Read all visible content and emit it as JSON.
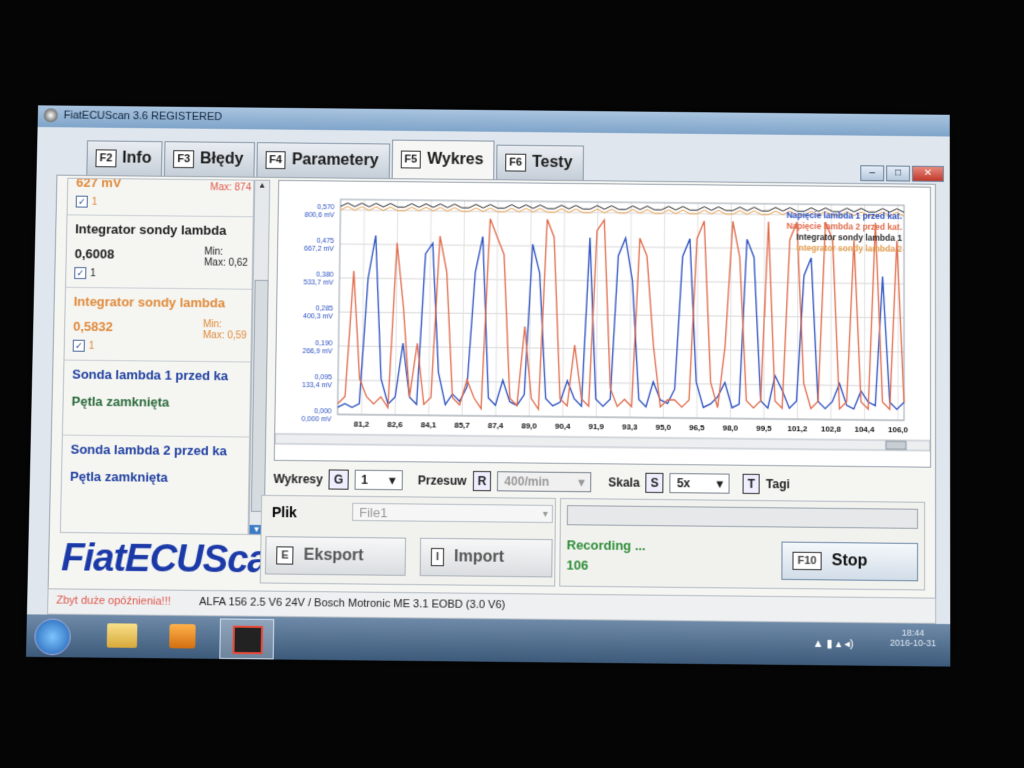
{
  "window": {
    "title": "FiatECUScan 3.6 REGISTERED"
  },
  "tabs": [
    {
      "key": "F2",
      "label": "Info"
    },
    {
      "key": "F3",
      "label": "Błędy"
    },
    {
      "key": "F4",
      "label": "Parametery"
    },
    {
      "key": "F5",
      "label": "Wykres",
      "active": true
    },
    {
      "key": "F6",
      "label": "Testy"
    }
  ],
  "left_panel": {
    "top_partial": {
      "value": "627 mV",
      "max": "Max: 874",
      "check": "1"
    },
    "items": [
      {
        "name": "Integrator sondy lambda",
        "value": "0,6008",
        "min": "Min:",
        "max": "Max: 0,62",
        "check": "1",
        "color": "#1c1c1c"
      },
      {
        "name": "Integrator sondy lambda",
        "value": "0,5832",
        "min": "Min:",
        "max": "Max: 0,59",
        "check": "1",
        "color": "#e08a3a"
      },
      {
        "name": "Sonda lambda 1 przed ka",
        "status": "Pętla zamknięta",
        "color": "#1f3fa0"
      },
      {
        "name": "Sonda lambda 2 przed ka",
        "status": "Pętla zamknięta",
        "color": "#1f3fa0"
      }
    ]
  },
  "logo": "FiatECUScan",
  "controls": {
    "wykresy_label": "Wykresy",
    "wykresy_key": "G",
    "wykresy_value": "1",
    "przesuw_label": "Przesuw",
    "przesuw_key": "R",
    "przesuw_value": "400/min",
    "skala_label": "Skala",
    "skala_key": "S",
    "skala_value": "5x",
    "tagi_key": "T",
    "tagi_label": "Tagi"
  },
  "file": {
    "label": "Plik",
    "value": "File1",
    "eksport_key": "E",
    "eksport_label": "Eksport",
    "import_key": "I",
    "import_label": "Import"
  },
  "recording": {
    "status": "Recording ...",
    "count": "106",
    "stop_key": "F10",
    "stop_label": "Stop"
  },
  "status_bar": {
    "warning": "Zbyt duże opóźnienia!!!",
    "vehicle": "ALFA 156 2.5 V6 24V / Bosch Motronic ME 3.1 EOBD (3.0 V6)"
  },
  "taskbar": {
    "time": "18:44",
    "date": "2016-10-31"
  },
  "chart_data": {
    "type": "line",
    "x_ticks": [
      "81,2",
      "82,6",
      "84,1",
      "85,7",
      "87,4",
      "89,0",
      "90,4",
      "91,9",
      "93,3",
      "95,0",
      "96,5",
      "98,0",
      "99,5",
      "101,2",
      "102,8",
      "104,4",
      "106,0"
    ],
    "y_ticks_left": [
      "0,570",
      "0,475",
      "0,380",
      "0,285",
      "0,190",
      "0,095",
      "0,000"
    ],
    "y_ticks_right": [
      "800,6 mV",
      "667,2 mV",
      "533,7 mV",
      "400,3 mV",
      "266,9 mV",
      "133,4 mV",
      "0,000 mV"
    ],
    "xlim": [
      80.4,
      106.0
    ],
    "ylim": [
      0,
      0.6
    ],
    "grid": true,
    "legend_position": "top-right",
    "series": [
      {
        "name": "Napięcie lambda 1 przed kat.",
        "color": "#2a4fc0",
        "values": [
          0.02,
          0.03,
          0.02,
          0.03,
          0.38,
          0.5,
          0.1,
          0.03,
          0.05,
          0.2,
          0.05,
          0.03,
          0.45,
          0.48,
          0.12,
          0.03,
          0.06,
          0.04,
          0.08,
          0.4,
          0.5,
          0.05,
          0.03,
          0.1,
          0.04,
          0.03,
          0.06,
          0.48,
          0.4,
          0.05,
          0.03,
          0.04,
          0.1,
          0.05,
          0.03,
          0.5,
          0.05,
          0.03,
          0.05,
          0.45,
          0.5,
          0.38,
          0.05,
          0.03,
          0.1,
          0.05,
          0.04,
          0.08,
          0.45,
          0.5,
          0.1,
          0.03,
          0.04,
          0.06,
          0.1,
          0.03,
          0.04,
          0.5,
          0.45,
          0.05,
          0.03,
          0.12,
          0.08,
          0.03,
          0.05,
          0.4,
          0.45,
          0.05,
          0.03,
          0.05,
          0.1,
          0.04,
          0.03,
          0.08,
          0.05,
          0.04,
          0.4,
          0.05,
          0.03,
          0.05
        ]
      },
      {
        "name": "Napięcie lambda 2 przed kat.",
        "color": "#e06a4a",
        "values": [
          0.03,
          0.05,
          0.4,
          0.1,
          0.05,
          0.03,
          0.05,
          0.02,
          0.48,
          0.3,
          0.05,
          0.2,
          0.03,
          0.05,
          0.5,
          0.4,
          0.05,
          0.03,
          0.1,
          0.05,
          0.02,
          0.55,
          0.5,
          0.45,
          0.05,
          0.03,
          0.25,
          0.05,
          0.02,
          0.55,
          0.5,
          0.05,
          0.03,
          0.2,
          0.05,
          0.03,
          0.52,
          0.55,
          0.08,
          0.03,
          0.05,
          0.03,
          0.5,
          0.45,
          0.2,
          0.03,
          0.05,
          0.05,
          0.03,
          0.05,
          0.5,
          0.55,
          0.1,
          0.03,
          0.2,
          0.55,
          0.45,
          0.05,
          0.03,
          0.05,
          0.55,
          0.05,
          0.03,
          0.5,
          0.55,
          0.1,
          0.03,
          0.05,
          0.55,
          0.5,
          0.03,
          0.05,
          0.5,
          0.05,
          0.03,
          0.55,
          0.05,
          0.03,
          0.5,
          0.05
        ]
      },
      {
        "name": "Integrator sondy lambda 1",
        "color": "#2b2b2b",
        "values": [
          0.58,
          0.59,
          0.58,
          0.59,
          0.58,
          0.59,
          0.58,
          0.59,
          0.58,
          0.58,
          0.59,
          0.58,
          0.59,
          0.58,
          0.59,
          0.58,
          0.59,
          0.58,
          0.58,
          0.59,
          0.58,
          0.59,
          0.58,
          0.58,
          0.59,
          0.58,
          0.59,
          0.58,
          0.59,
          0.58,
          0.58,
          0.59,
          0.58,
          0.59,
          0.58,
          0.58,
          0.59,
          0.58,
          0.59,
          0.58,
          0.58,
          0.59,
          0.58,
          0.59,
          0.58,
          0.58,
          0.59,
          0.58,
          0.59,
          0.58,
          0.58,
          0.59,
          0.58,
          0.59,
          0.58,
          0.58,
          0.59,
          0.58,
          0.59,
          0.58,
          0.58,
          0.59,
          0.58,
          0.59,
          0.58,
          0.58,
          0.59,
          0.58,
          0.59,
          0.58,
          0.58,
          0.59,
          0.58,
          0.59,
          0.58,
          0.58,
          0.59,
          0.58,
          0.59,
          0.58
        ]
      },
      {
        "name": "Integrator sondy lambda 2",
        "color": "#e8a050",
        "values": [
          0.57,
          0.58,
          0.57,
          0.58,
          0.57,
          0.58,
          0.57,
          0.58,
          0.57,
          0.57,
          0.58,
          0.57,
          0.58,
          0.57,
          0.58,
          0.57,
          0.58,
          0.57,
          0.57,
          0.58,
          0.57,
          0.58,
          0.57,
          0.57,
          0.58,
          0.57,
          0.58,
          0.57,
          0.58,
          0.57,
          0.57,
          0.58,
          0.57,
          0.58,
          0.57,
          0.57,
          0.58,
          0.57,
          0.58,
          0.57,
          0.57,
          0.58,
          0.57,
          0.58,
          0.57,
          0.57,
          0.58,
          0.57,
          0.58,
          0.57,
          0.57,
          0.58,
          0.57,
          0.58,
          0.57,
          0.57,
          0.58,
          0.57,
          0.58,
          0.57,
          0.57,
          0.58,
          0.57,
          0.58,
          0.57,
          0.57,
          0.58,
          0.57,
          0.58,
          0.57,
          0.57,
          0.58,
          0.57,
          0.58,
          0.57,
          0.57,
          0.58,
          0.57,
          0.58,
          0.57
        ]
      }
    ]
  }
}
